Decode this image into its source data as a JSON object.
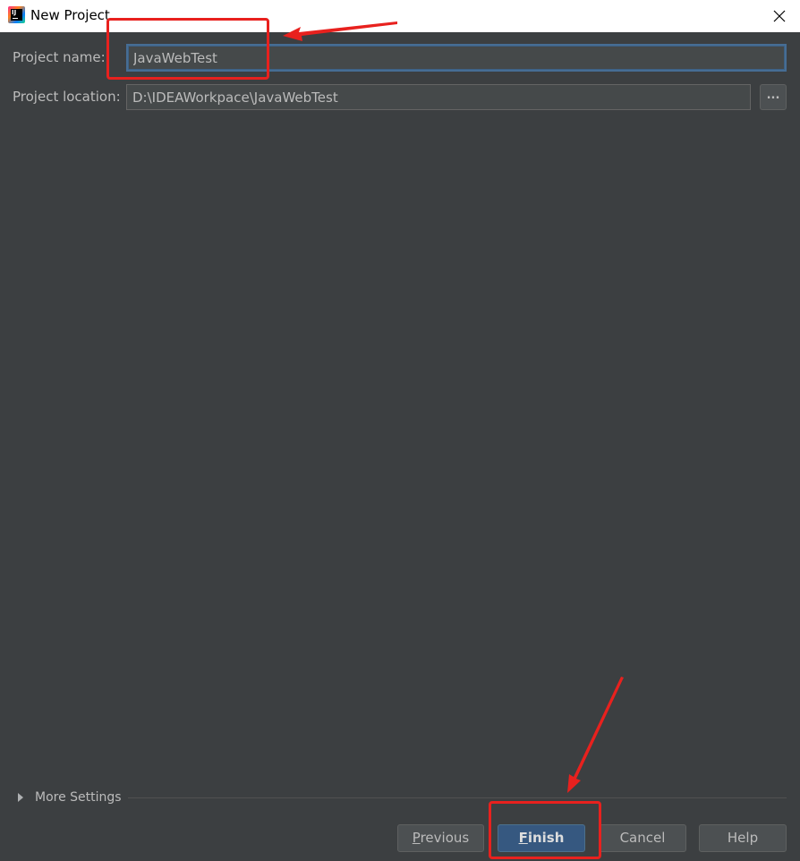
{
  "window": {
    "title": "New Project",
    "app_icon": "intellij-idea-icon",
    "close_icon": "close-icon"
  },
  "form": {
    "project_name": {
      "label": "Project name:",
      "value": "JavaWebTest"
    },
    "project_location": {
      "label": "Project location:",
      "value": "D:\\IDEAWorkpace\\JavaWebTest",
      "browse_label": "..."
    }
  },
  "more_settings": {
    "label": "More Settings",
    "expanded": false
  },
  "buttons": {
    "previous": {
      "mnemonic": "P",
      "rest": "revious"
    },
    "finish": {
      "mnemonic": "F",
      "rest": "inish"
    },
    "cancel": "Cancel",
    "help": "Help"
  },
  "annotations": {
    "color": "#e8211e",
    "highlights": [
      "project-name-field",
      "finish-button"
    ]
  },
  "colors": {
    "background": "#3c3f41",
    "input_background": "#45494a",
    "focus_border": "#466d94",
    "primary_button": "#365880",
    "text": "#bbbbbb"
  }
}
